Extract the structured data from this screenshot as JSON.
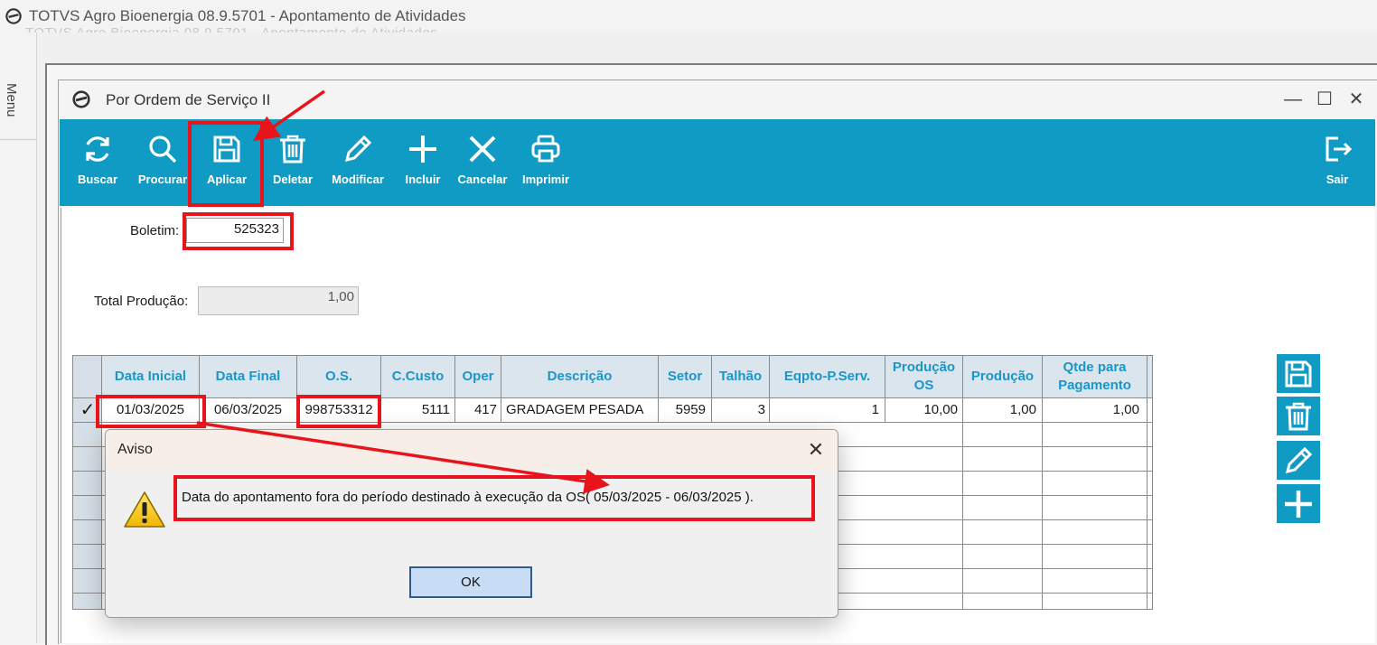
{
  "app": {
    "title": "TOTVS Agro Bioenergia 08.9.5701 - Apontamento de Atividades",
    "ghost_title": "TOTVS Agro Bioenergia 08.9.5701 - Apontamento de Atividades"
  },
  "sidebar": {
    "menu_label": "Menu"
  },
  "child_window": {
    "title": "Por Ordem de Serviço II",
    "minimize_glyph": "—",
    "maximize_glyph": "☐",
    "close_glyph": "✕"
  },
  "toolbar": {
    "buscar": "Buscar",
    "procurar": "Procurar",
    "aplicar": "Aplicar",
    "deletar": "Deletar",
    "modificar": "Modificar",
    "incluir": "Incluir",
    "cancelar": "Cancelar",
    "imprimir": "Imprimir",
    "sair": "Sair",
    "accent_color": "#0f9bc3"
  },
  "form": {
    "boletim_label": "Boletim:",
    "boletim_value": "525323",
    "total_label": "Total Produção:",
    "total_value": "1,00"
  },
  "grid": {
    "columns": [
      "Data Inicial",
      "Data Final",
      "O.S.",
      "C.Custo",
      "Oper",
      "Descrição",
      "Setor",
      "Talhão",
      "Eqpto-P.Serv.",
      "Produção OS",
      "Produção",
      "Qtde para Pagamento"
    ],
    "row": {
      "indicator": "✓",
      "data_inicial": "01/03/2025",
      "data_final": "06/03/2025",
      "os": "998753312",
      "ccusto": "5111",
      "oper": "417",
      "descricao": "GRADAGEM PESADA",
      "setor": "5959",
      "talhao": "3",
      "eqpto": "1",
      "producao_os": "10,00",
      "producao": "1,00",
      "qtde_pagamento": "1,00"
    }
  },
  "dialog": {
    "title": "Aviso",
    "close_glyph": "✕",
    "message": "Data do apontamento fora do período destinado à execução da OS( 05/03/2025 - 06/03/2025 ).",
    "ok_label": "OK"
  },
  "annotation_color": "#e8141c"
}
